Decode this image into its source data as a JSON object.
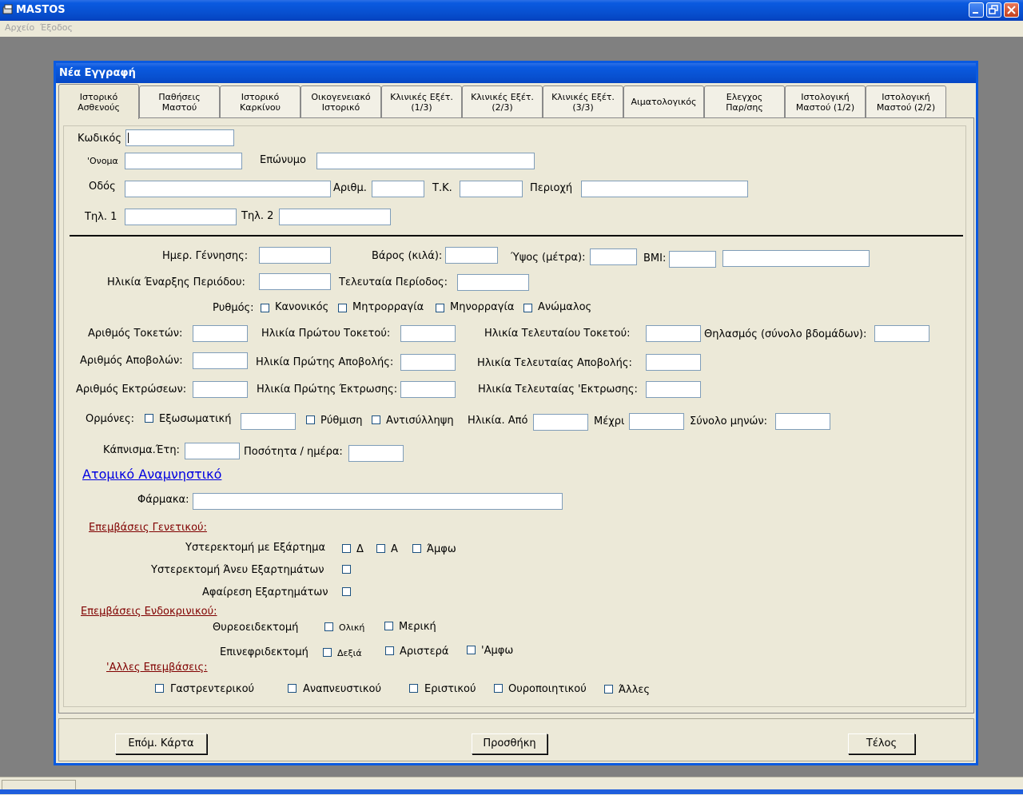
{
  "app": {
    "title": "MASTOS"
  },
  "menu": {
    "items": [
      "Αρχείο",
      "Έξοδος"
    ]
  },
  "window": {
    "title": "Νέα Εγγραφή"
  },
  "tabs": [
    {
      "line1": "Ιστορικό",
      "line2": "Ασθενούς"
    },
    {
      "line1": "Παθήσεις",
      "line2": "Μαστού"
    },
    {
      "line1": "Ιστορικό",
      "line2": "Καρκίνου"
    },
    {
      "line1": "Οικογενειακό",
      "line2": "Ιστορικό"
    },
    {
      "line1": "Κλινικές Εξέτ.",
      "line2": "(1/3)"
    },
    {
      "line1": "Κλινικές Εξέτ.",
      "line2": "(2/3)"
    },
    {
      "line1": "Κλινικές Εξέτ.",
      "line2": "(3/3)"
    },
    {
      "line1": "Αιματολογικός",
      "line2": ""
    },
    {
      "line1": "Ελεγχος",
      "line2": "Παρ/σης"
    },
    {
      "line1": "Ιστολογική",
      "line2": "Μαστού (1/2)"
    },
    {
      "line1": "Ιστολογική",
      "line2": "Μαστού (2/2)"
    }
  ],
  "personal": {
    "code_label": "Κωδικός",
    "name_label": "'Ονομα",
    "surname_label": "Επώνυμο",
    "street_label": "Οδός",
    "number_label": "Αριθμ.",
    "zip_label": "Τ.Κ.",
    "area_label": "Περιοχή",
    "phone1_label": "Τηλ. 1",
    "phone2_label": "Τηλ. 2"
  },
  "body": {
    "birth_label": "Ημερ. Γέννησης:",
    "weight_label": "Βάρος (κιλά):",
    "height_label": "Ύψος (μέτρα):",
    "bmi_label": "BMI:",
    "menarche_label": "Ηλικία Έναρξης Περιόδου:",
    "last_period_label": "Τελευταία Περίοδος:",
    "rhythm_label": "Ρυθμός:",
    "rhythm_opts": [
      "Κανονικός",
      "Μητρορραγία",
      "Μηνορραγία",
      "Ανώμαλος"
    ],
    "births_label": "Αριθμός Τοκετών:",
    "first_birth_label": "Ηλικία Πρώτου Τοκετού:",
    "last_birth_label": "Ηλικία Τελευταίου Τοκετού:",
    "breastfeeding_label": "Θηλασμός (σύνολο βδομάδων):",
    "miscarriages_label": "Αριθμός Αποβολών:",
    "first_misc_label": "Ηλικία Πρώτης Αποβολής:",
    "last_misc_label": "Ηλικία Τελευταίας Αποβολής:",
    "abortions_label": "Αριθμός Εκτρώσεων:",
    "first_abort_label": "Ηλικία Πρώτης Έκτρωσης:",
    "last_abort_label": "Ηλικία Τελευταίας 'Εκτρωσης:",
    "hormones_label": "Ορμόνες:",
    "hormone_opt1": "Εξωσωματική",
    "hormone_opt2": "Ρύθμιση",
    "hormone_opt3": "Αντισύλληψη",
    "age_from_label": "Ηλικία. Από",
    "to_label": "Μέχρι",
    "total_months_label": "Σύνολο μηνών:",
    "smoking_label": "Κάπνισμα.Έτη:",
    "per_day_label": "Ποσότητα / ημέρα:"
  },
  "history": {
    "link": "Ατομικό Αναμνηστικό",
    "drugs_label": "Φάρμακα:",
    "gyn_title": "Επεμβάσεις Γενετικού:",
    "hyst_adnexa_label": "Υστερεκτομή με Εξάρτημα",
    "opt_d": "Δ",
    "opt_a": "Α",
    "opt_both": "Άμφω",
    "hyst_no_adnexa_label": "Υστερεκτομή Άνευ Εξαρτημάτων",
    "adnexa_removal_label": "Αφαίρεση Εξαρτημάτων",
    "endo_title": "Επεμβάσεις Ενδοκρινικού:",
    "thyroid_label": "Θυρεοειδεκτομή",
    "thyroid_total": "Ολική",
    "thyroid_partial": "Μερική",
    "adrenal_label": "Επινεφριδεκτομή",
    "adrenal_right": "Δεξιά",
    "adrenal_left": "Αριστερά",
    "adrenal_both": "'Αμφω",
    "other_title": "'Αλλες Επεμβάσεις:",
    "other_opts": [
      "Γαστρεντερικού",
      "Αναπνευστικού",
      "Εριστικού",
      "Ουροποιητικού",
      "Άλλες"
    ]
  },
  "buttons": {
    "next": "Επόμ. Κάρτα",
    "add": "Προσθήκη",
    "end": "Τέλος"
  }
}
